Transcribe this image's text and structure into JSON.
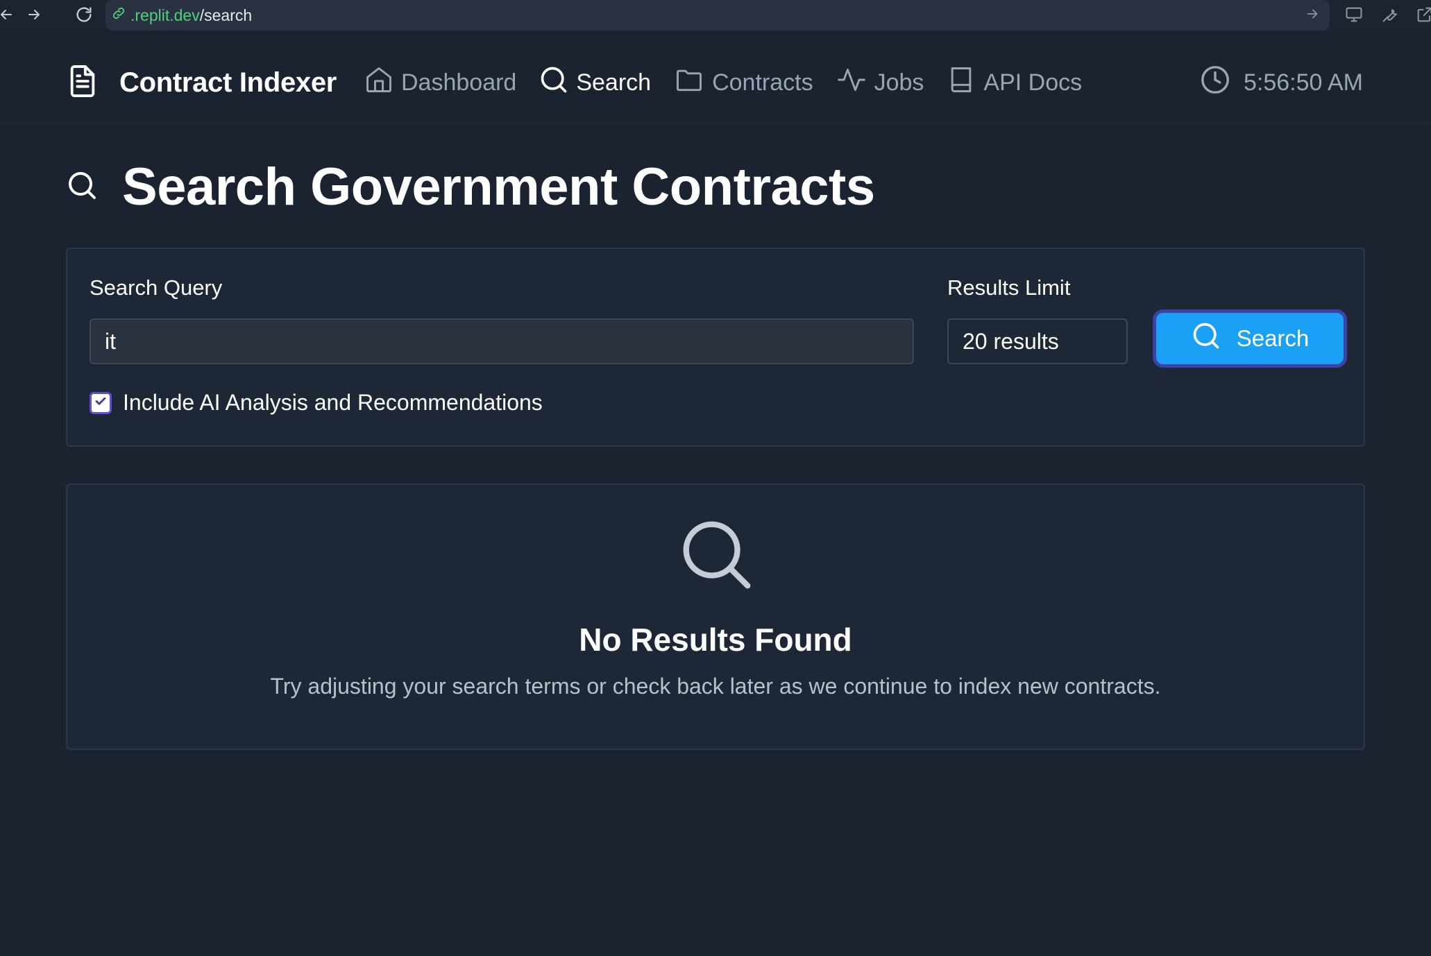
{
  "browser": {
    "url_domain": ".replit.dev",
    "url_path": "/search"
  },
  "header": {
    "brand": "Contract Indexer",
    "nav": [
      {
        "label": "Dashboard",
        "icon": "home-icon"
      },
      {
        "label": "Search",
        "icon": "search-icon",
        "active": true
      },
      {
        "label": "Contracts",
        "icon": "folder-icon"
      },
      {
        "label": "Jobs",
        "icon": "activity-icon"
      },
      {
        "label": "API Docs",
        "icon": "book-icon"
      }
    ],
    "clock": "5:56:50 AM"
  },
  "page": {
    "title": "Search Government Contracts"
  },
  "search": {
    "query_label": "Search Query",
    "query_value": "it",
    "limit_label": "Results Limit",
    "limit_value": "20 results",
    "button_label": "Search",
    "ai_checkbox_label": "Include AI Analysis and Recommendations",
    "ai_checked": true
  },
  "results": {
    "empty_title": "No Results Found",
    "empty_text": "Try adjusting your search terms or check back later as we continue to index new contracts."
  },
  "colors": {
    "background": "#1b2330",
    "card": "#1e2735",
    "accent": "#1aa0f5",
    "focus_ring": "#3b43a8",
    "url_green": "#4fd27a"
  }
}
